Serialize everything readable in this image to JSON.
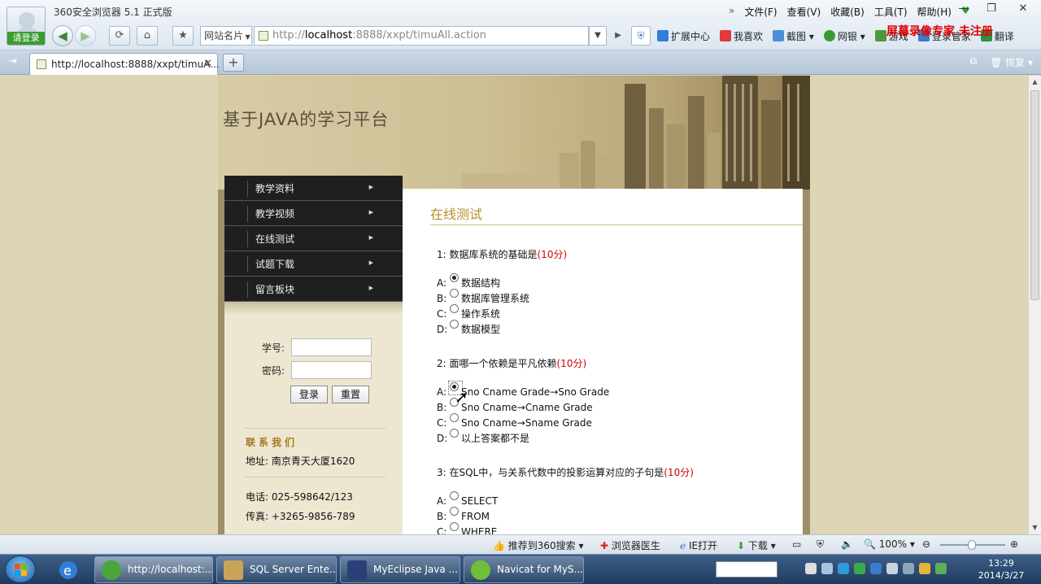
{
  "browser": {
    "title": "360安全浏览器 5.1 正式版",
    "login_badge": "请登录",
    "menu": [
      "文件(F)",
      "查看(V)",
      "收藏(B)",
      "工具(T)",
      "帮助(H)"
    ],
    "menu_chevron": "»",
    "site_card_label": "网站名片",
    "url_prefix": "http://",
    "url_host": "localhost",
    "url_rest": ":8888/xxpt/timuAll.action",
    "tools": [
      "扩展中心",
      "我喜欢",
      "截图",
      "网银",
      "游戏",
      "登录管家",
      "翻译"
    ],
    "watermark": "屏幕录像专家 未注册",
    "tab_title": "http://localhost:8888/xxpt/timuA...",
    "tab_right_label": "恢复",
    "colors": {
      "accent_green": "#3b9b2f",
      "watermark_red": "#e00000"
    }
  },
  "site": {
    "title": "基于JAVA的学习平台",
    "nav": [
      "教学资料",
      "教学视频",
      "在线测试",
      "试题下载",
      "留言板块"
    ],
    "login": {
      "student_id_label": "学号:",
      "student_id_value": "",
      "password_label": "密码:",
      "password_value": "",
      "login_button": "登录",
      "reset_button": "重置"
    },
    "contact": {
      "title": "联系我们",
      "address": "地址:  南京青天大厦1620",
      "phone": "电话:  025-598642/123",
      "fax": "传真:  +3265-9856-789"
    }
  },
  "quiz": {
    "title": "在线测试",
    "questions": [
      {
        "text": "1: 数据库系统的基础是",
        "score": "(10分)",
        "options": [
          {
            "letter": "A:",
            "text": "数据结构",
            "checked": true
          },
          {
            "letter": "B:",
            "text": "数据库管理系统",
            "checked": false
          },
          {
            "letter": "C:",
            "text": "操作系统",
            "checked": false
          },
          {
            "letter": "D:",
            "text": "数据模型",
            "checked": false
          }
        ]
      },
      {
        "text": "2: 面哪一个依赖是平凡依赖",
        "score": "(10分)",
        "options": [
          {
            "letter": "A:",
            "text": "Sno Cname Grade→Sno Grade",
            "checked": true
          },
          {
            "letter": "B:",
            "text": "Sno Cname→Cname Grade",
            "checked": false
          },
          {
            "letter": "C:",
            "text": "Sno Cname→Sname Grade",
            "checked": false
          },
          {
            "letter": "D:",
            "text": "以上答案都不是",
            "checked": false
          }
        ]
      },
      {
        "text": "3: 在SQL中，与关系代数中的投影运算对应的子句是",
        "score": "(10分)",
        "options": [
          {
            "letter": "A:",
            "text": "SELECT",
            "checked": false
          },
          {
            "letter": "B:",
            "text": "FROM",
            "checked": false
          },
          {
            "letter": "C:",
            "text": "WHERE",
            "checked": false
          }
        ]
      }
    ]
  },
  "statusbar": {
    "recommend": "推荐到360搜索",
    "doctor": "浏览器医生",
    "ie_open": "IE打开",
    "download": "下载",
    "zoom": "100%",
    "zoom_level_percent": 100
  },
  "taskbar": {
    "tasks": [
      "http://localhost:...",
      "SQL Server Ente...",
      "MyEclipse Java ...",
      "Navicat for MyS..."
    ],
    "time": "13:29",
    "date": "2014/3/27"
  }
}
